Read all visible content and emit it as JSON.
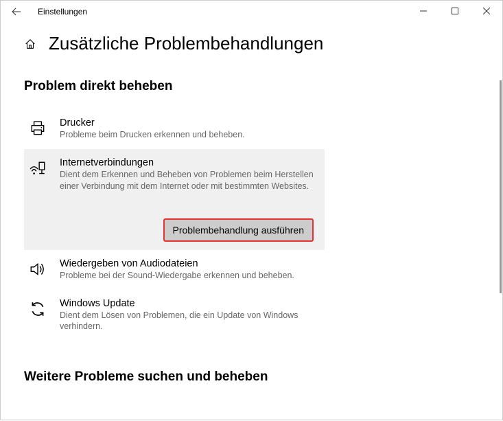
{
  "window": {
    "title": "Einstellungen"
  },
  "page": {
    "title": "Zusätzliche Problembehandlungen"
  },
  "section1": {
    "heading": "Problem direkt beheben",
    "items": [
      {
        "title": "Drucker",
        "desc": "Probleme beim Drucken erkennen und beheben."
      },
      {
        "title": "Internetverbindungen",
        "desc": "Dient dem Erkennen und Beheben von Problemen beim Herstellen einer Verbindung mit dem Internet oder mit bestimmten Websites.",
        "button": "Problembehandlung ausführen"
      },
      {
        "title": "Wiedergeben von Audiodateien",
        "desc": "Probleme bei der Sound-Wiedergabe erkennen und beheben."
      },
      {
        "title": "Windows Update",
        "desc": "Dient dem Lösen von Problemen, die ein Update von Windows verhindern."
      }
    ]
  },
  "section2": {
    "heading": "Weitere Probleme suchen und beheben"
  }
}
